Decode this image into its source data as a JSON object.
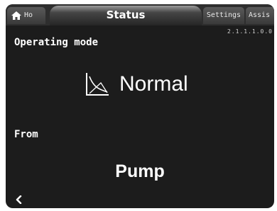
{
  "tabs": {
    "home": {
      "label": "Ho",
      "icon": "home-icon"
    },
    "active": {
      "label": "Status"
    },
    "settings": {
      "label": "Settings"
    },
    "assist": {
      "label": "Assis"
    }
  },
  "version": "2.1.1.1.0.0",
  "operating_mode": {
    "title": "Operating mode",
    "value": "Normal",
    "icon": "normal-mode-curve-icon"
  },
  "control_source": {
    "title": "From",
    "value": "Pump"
  },
  "nav": {
    "back_icon": "chevron-left-icon"
  },
  "colors": {
    "background": "#1c1c1c",
    "text": "#ffffff",
    "tab": "#4a4a4a"
  }
}
